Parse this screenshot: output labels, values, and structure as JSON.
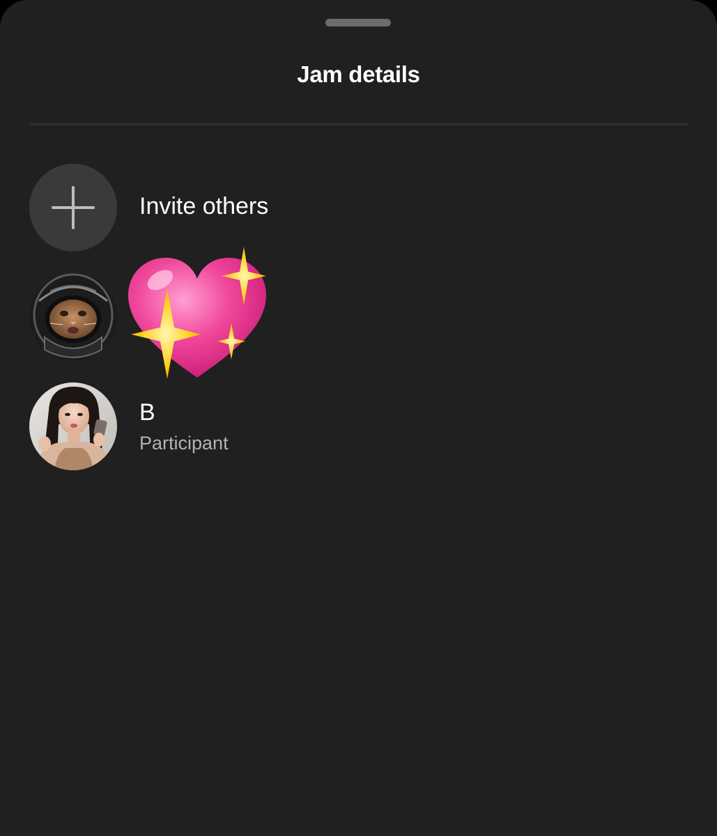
{
  "sheet": {
    "title": "Jam details"
  },
  "invite": {
    "label": "Invite others",
    "icon": "plus-icon"
  },
  "participants": [
    {
      "name_display": "sparkling-heart-emoji",
      "avatar": "cat-in-helmet-avatar"
    },
    {
      "name": "B",
      "role": "Participant",
      "avatar": "person-photo-avatar"
    }
  ],
  "colors": {
    "background": "#202020",
    "invite_circle": "#3a3a3a",
    "text_primary": "#ffffff",
    "text_secondary": "#b3b3b3",
    "heart_pink": "#f0479b",
    "sparkle_yellow": "#ffd21f"
  }
}
